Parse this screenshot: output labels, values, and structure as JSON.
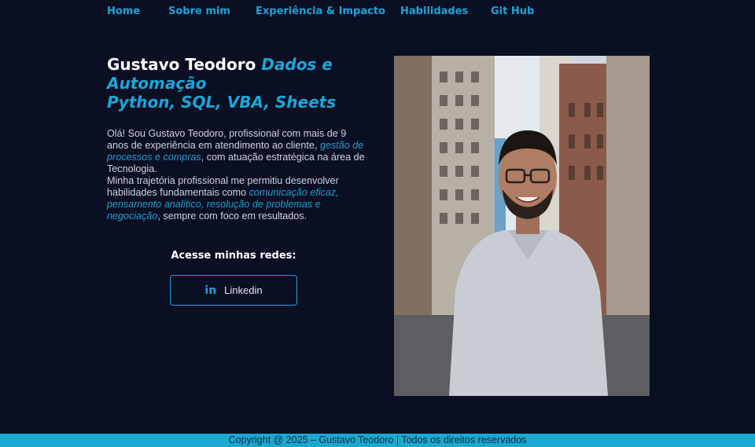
{
  "nav": {
    "items": [
      {
        "label": "Home"
      },
      {
        "label": "Sobre mim"
      },
      {
        "label": "Experiência & Impacto"
      },
      {
        "label": "Habilidades"
      },
      {
        "label": "Git Hub"
      }
    ]
  },
  "hero": {
    "name": "Gustavo Teodoro",
    "tagline_1": "Dados e Automação",
    "tagline_2": "Python, SQL, VBA, Sheets"
  },
  "bio": {
    "p1_a": "Olá! Sou Gustavo Teodoro, profissional com mais de 9 anos de experiência em atendimento ao cliente,",
    "p1_hl": "gestão de processos e compras",
    "p1_b": ", com atuação estratégica na área de Tecnologia.",
    "p2_a": "Minha trajetória profissional me permitiu desenvolver habilidades fundamentais como",
    "p2_hl": "comunicação eficaz, pensamento analítico, resolução de problemas e negociação",
    "p2_b": ", sempre com foco em resultados."
  },
  "social": {
    "title": "Acesse minhas redes:",
    "linkedin_icon": "in",
    "linkedin_label": "Linkedin"
  },
  "photo": {
    "alt": "Gustavo Teodoro"
  },
  "footer": {
    "text": "Copyright @ 2025 – Gustavo Teodoro | Todos os direitos reservados"
  },
  "colors": {
    "background": "#0a0f24",
    "accent": "#1aa3d6",
    "footer": "#1aa9d0"
  }
}
